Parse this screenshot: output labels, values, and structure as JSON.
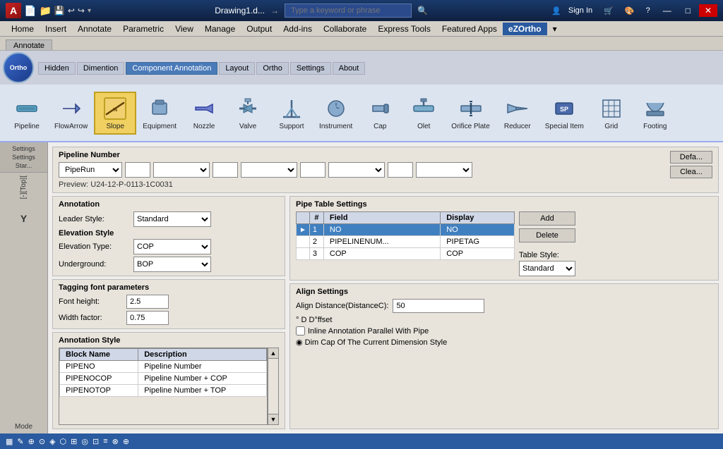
{
  "titlebar": {
    "filename": "Drawing1.d...",
    "arrow": "→",
    "search_placeholder": "Type a keyword or phrase",
    "sign_in": "Sign In",
    "cart_icon": "🛒",
    "settings_icon": "⚙",
    "help_icon": "?",
    "min_btn": "—",
    "max_btn": "□",
    "close_btn": "✕"
  },
  "menubar": {
    "items": [
      "Home",
      "Insert",
      "Annotate",
      "Parametric",
      "View",
      "Manage",
      "Output",
      "Add-ins",
      "Collaborate",
      "Express Tools",
      "Featured Apps",
      "eZOrtho",
      "▾"
    ]
  },
  "ribbon_tabs": {
    "active": "Annotate",
    "items": [
      "Annotate"
    ]
  },
  "plugin": {
    "logo_text": "Ortho",
    "tabs": [
      "Hidden",
      "Dimention",
      "Component Annotation",
      "Layout",
      "Ortho",
      "Settings",
      "About"
    ],
    "active_tab": "Component Annotation"
  },
  "tools": [
    {
      "id": "pipeline",
      "label": "Pipeline",
      "active": false
    },
    {
      "id": "flowarrow",
      "label": "FlowArrow",
      "active": false
    },
    {
      "id": "slope",
      "label": "Slope",
      "active": true
    },
    {
      "id": "equipment",
      "label": "Equipment",
      "active": false
    },
    {
      "id": "nozzle",
      "label": "Nozzle",
      "active": false
    },
    {
      "id": "valve",
      "label": "Valve",
      "active": false
    },
    {
      "id": "support",
      "label": "Support",
      "active": false
    },
    {
      "id": "instrument",
      "label": "Instrument",
      "active": false
    },
    {
      "id": "cap",
      "label": "Cap",
      "active": false
    },
    {
      "id": "olet",
      "label": "Olet",
      "active": false
    },
    {
      "id": "orificeplate",
      "label": "Orifice Plate",
      "active": false
    },
    {
      "id": "reducer",
      "label": "Reducer",
      "active": false
    },
    {
      "id": "specialitem",
      "label": "Special Item",
      "active": false
    },
    {
      "id": "grid",
      "label": "Grid",
      "active": false
    },
    {
      "id": "footing",
      "label": "Footing",
      "active": false
    }
  ],
  "pipelinenumber": {
    "title": "Pipeline Number",
    "select_value": "PipeRun",
    "preview_label": "Preview:",
    "preview_value": "U24-12-P-0113-1C0031",
    "btn_default": "Defa...",
    "btn_clear": "Clea..."
  },
  "annotation": {
    "title": "Annotation",
    "leader_style_label": "Leader Style:",
    "leader_style_value": "Standard",
    "elevation_style_label": "Elevation Style",
    "elevation_type_label": "Elevation Type:",
    "elevation_type_value": "COP",
    "underground_label": "Underground:",
    "underground_value": "BOP"
  },
  "tagging_font": {
    "title": "Tagging font parameters",
    "font_height_label": "Font height:",
    "font_height_value": "2.5",
    "width_factor_label": "Width factor:",
    "width_factor_value": "0.75"
  },
  "pipe_table": {
    "title": "Pipe Table Settings",
    "columns": [
      "Field",
      "Display"
    ],
    "rows": [
      {
        "num": "1",
        "field": "NO",
        "display": "NO",
        "selected": true,
        "arrow": "►"
      },
      {
        "num": "2",
        "field": "PIPELINENUM...",
        "display": "PIPETAG",
        "selected": false
      },
      {
        "num": "3",
        "field": "COP",
        "display": "COP",
        "selected": false
      }
    ],
    "btn_add": "Add",
    "btn_delete": "Delete",
    "table_style_label": "Table Style:",
    "table_style_value": "Standard"
  },
  "annotation_style": {
    "title": "Annotation Style",
    "columns": [
      "Block Name",
      "Description"
    ],
    "rows": [
      {
        "block": "PIPENO",
        "description": "Pipeline Number"
      },
      {
        "block": "PIPENOCOP",
        "description": "Pipeline Number + COP"
      },
      {
        "block": "PIPENOTOP",
        "description": "Pipeline Number + TOP"
      }
    ]
  },
  "align_settings": {
    "title": "Align Settings",
    "distance_label": "Align Distance(DistanceC):",
    "distance_value": "50",
    "offset_label": "° D D°ffset",
    "checkbox_label": "Inline Annotation Parallel With Pipe",
    "radio_label": "◉ Dim Cap Of The Current Dimension Style"
  },
  "cad_sidebar": {
    "view_label": "[-][Top][",
    "y_label": "Y",
    "mode_label": "Mode"
  },
  "status_bar": {
    "items": [
      "▦",
      "✐",
      "⊕",
      "⊙",
      "◈",
      "⬡",
      "⊞",
      "◉",
      "⊡",
      "≡",
      "⊗",
      "⊕"
    ]
  }
}
